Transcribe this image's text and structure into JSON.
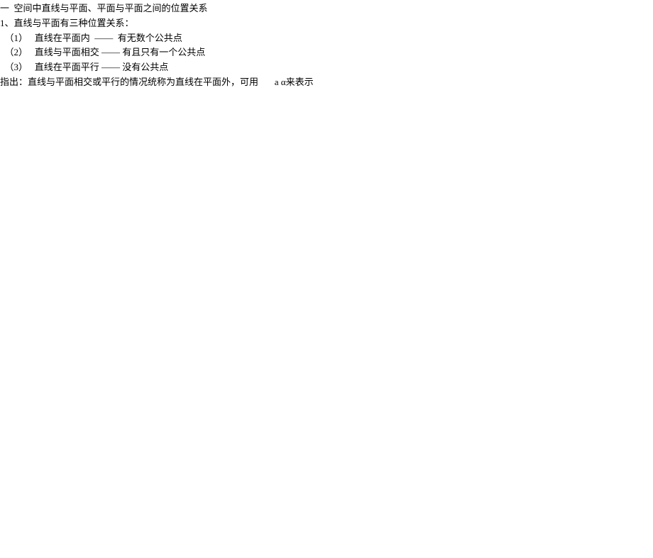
{
  "heading": "一  空间中直线与平面、平面与平面之间的位置关系",
  "subheading": "1、直线与平面有三种位置关系：",
  "items": [
    "（1）   直线在平面内  ——  有无数个公共点",
    "（2）   直线与平面相交 —— 有且只有一个公共点",
    "（3）   直线在平面平行 —— 没有公共点"
  ],
  "note": "指出：直线与平面相交或平行的情况统称为直线在平面外，可用       a α来表示"
}
